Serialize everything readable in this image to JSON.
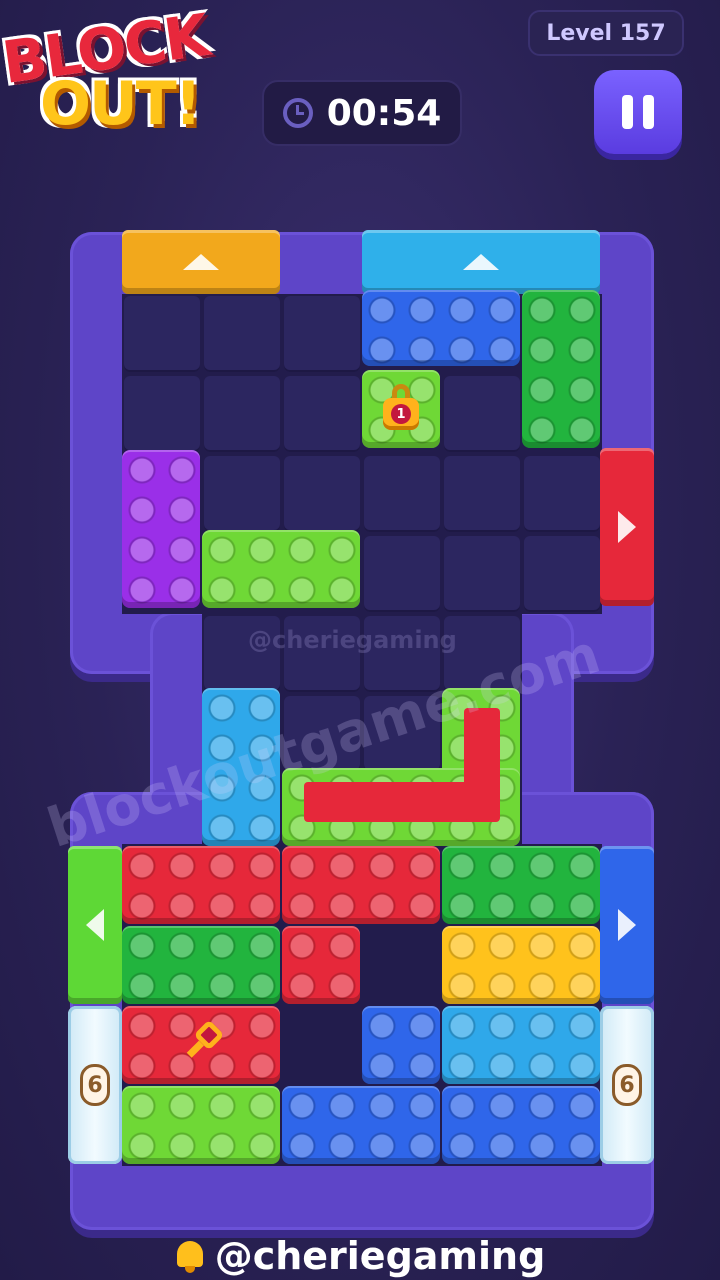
{
  "logo": {
    "line1": "BLOCK",
    "line2": "OUT!"
  },
  "level": {
    "label": "Level 157"
  },
  "timer": {
    "value": "00:54"
  },
  "board": {
    "lock_number": "1",
    "ice_left_count": "6",
    "ice_right_count": "6"
  },
  "watermarks": {
    "small": "@cheriegaming",
    "large": "blockoutgame.com"
  },
  "footer": {
    "handle": "@cheriegaming"
  },
  "icons": [
    "clock-icon",
    "pause-icon",
    "lock-icon",
    "key-icon",
    "bell-icon"
  ],
  "colors": {
    "blue": "#2f66ea",
    "green": "#22b43e",
    "lime": "#6fd836",
    "purple": "#9a2fe8",
    "cyan": "#2fa8ea",
    "red": "#e6283a",
    "yellow": "#ffc21c"
  }
}
